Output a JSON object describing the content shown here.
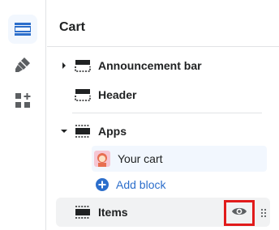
{
  "rail": {
    "items": [
      {
        "name": "sections",
        "icon": "sections-icon",
        "active": true
      },
      {
        "name": "theme-settings",
        "icon": "paint-brush-icon",
        "active": false
      },
      {
        "name": "app-embeds",
        "icon": "apps-icon",
        "active": false
      }
    ]
  },
  "panel": {
    "title": "Cart",
    "sections": [
      {
        "label": "Announcement bar",
        "expandable": true,
        "expanded": false
      },
      {
        "label": "Header",
        "expandable": false
      },
      {
        "label": "Apps",
        "expandable": true,
        "expanded": true
      },
      {
        "label": "Items",
        "expandable": false,
        "hover": true
      }
    ],
    "app_blocks": [
      {
        "label": "Your cart"
      }
    ],
    "add_block_label": "Add block"
  },
  "colors": {
    "accent": "#2c6ecb",
    "selected_bg": "#f2f7fe",
    "hover_bg": "#f1f2f3",
    "highlight_box": "#e11b1b"
  }
}
